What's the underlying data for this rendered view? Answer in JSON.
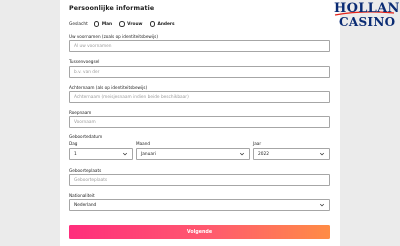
{
  "brand": {
    "line1": "HOLLAND",
    "line2": "CASINO",
    "color": "#0a2b73",
    "accent": "#e2231a"
  },
  "section": {
    "title": "Persoonlijke informatie"
  },
  "gender": {
    "label": "Geslacht",
    "options": [
      "Man",
      "Vrouw",
      "Anders"
    ]
  },
  "fields": {
    "first_names": {
      "label": "Uw voornamen (zoals op identiteitsbewijs)",
      "placeholder": "Al uw voornamen"
    },
    "infix": {
      "label": "Tussenvoegsel",
      "placeholder": "b.v. van der"
    },
    "surname": {
      "label": "Achternaam (als op identiteitsbewijs)",
      "placeholder": "Achternaam (meisjesnaam indien beide beschikbaar)"
    },
    "callname": {
      "label": "Roepnaam",
      "placeholder": "Voornaam"
    },
    "birthdate": {
      "label": "Geboortedatum",
      "day": {
        "label": "Dag",
        "value": "1"
      },
      "month": {
        "label": "Maand",
        "value": "Januari"
      },
      "year": {
        "label": "Jaar",
        "value": "2022"
      }
    },
    "birthplace": {
      "label": "Geboorteplaats",
      "placeholder": "Geboorteplaats"
    },
    "nationality": {
      "label": "Nationaliteit",
      "value": "Nederland"
    }
  },
  "submit": {
    "label": "Volgende",
    "gradient_start": "#ff2d7c",
    "gradient_end": "#ff8c45"
  }
}
